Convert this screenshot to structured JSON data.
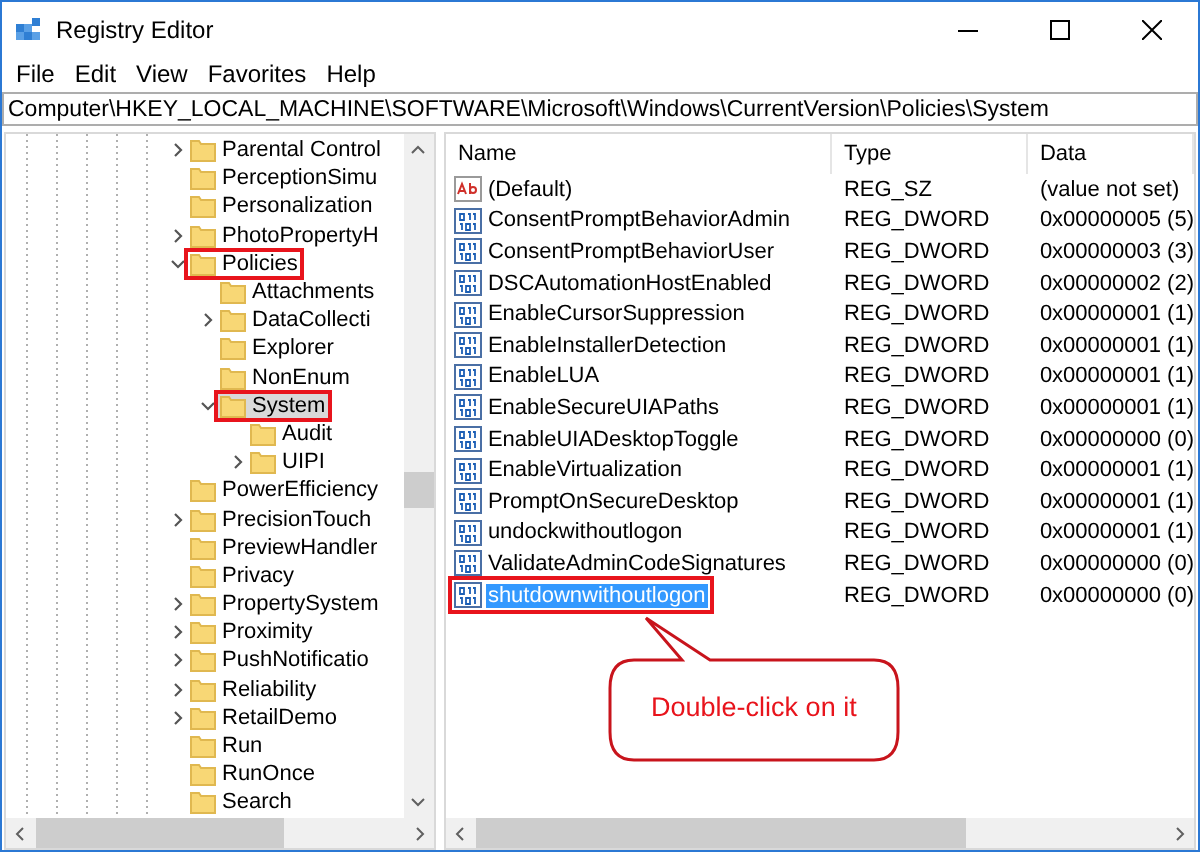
{
  "window": {
    "title": "Registry Editor"
  },
  "menu": [
    "File",
    "Edit",
    "View",
    "Favorites",
    "Help"
  ],
  "address": "Computer\\HKEY_LOCAL_MACHINE\\SOFTWARE\\Microsoft\\Windows\\CurrentVersion\\Policies\\System",
  "tree": [
    {
      "label": "Parental Control",
      "expandable": true,
      "expanded": false,
      "selected": false,
      "highlighted": false
    },
    {
      "label": "PerceptionSimu",
      "expandable": false,
      "selected": false,
      "highlighted": false
    },
    {
      "label": "Personalization",
      "expandable": false,
      "selected": false,
      "highlighted": false
    },
    {
      "label": "PhotoPropertyH",
      "expandable": true,
      "expanded": false,
      "selected": false,
      "highlighted": false
    },
    {
      "label": "Policies",
      "expandable": true,
      "expanded": true,
      "selected": false,
      "highlighted": true,
      "children": [
        {
          "label": "Attachments",
          "expandable": false,
          "selected": false,
          "highlighted": false
        },
        {
          "label": "DataCollecti",
          "expandable": true,
          "expanded": false,
          "selected": false,
          "highlighted": false
        },
        {
          "label": "Explorer",
          "expandable": false,
          "selected": false,
          "highlighted": false
        },
        {
          "label": "NonEnum",
          "expandable": false,
          "selected": false,
          "highlighted": false
        },
        {
          "label": "System",
          "expandable": true,
          "expanded": true,
          "selected": true,
          "highlighted": true,
          "children": [
            {
              "label": "Audit",
              "expandable": false,
              "selected": false,
              "highlighted": false
            },
            {
              "label": "UIPI",
              "expandable": true,
              "expanded": false,
              "selected": false,
              "highlighted": false
            }
          ]
        }
      ]
    },
    {
      "label": "PowerEfficiency",
      "expandable": false,
      "selected": false,
      "highlighted": false
    },
    {
      "label": "PrecisionTouch",
      "expandable": true,
      "expanded": false,
      "selected": false,
      "highlighted": false
    },
    {
      "label": "PreviewHandler",
      "expandable": false,
      "selected": false,
      "highlighted": false
    },
    {
      "label": "Privacy",
      "expandable": false,
      "selected": false,
      "highlighted": false
    },
    {
      "label": "PropertySystem",
      "expandable": true,
      "expanded": false,
      "selected": false,
      "highlighted": false
    },
    {
      "label": "Proximity",
      "expandable": true,
      "expanded": false,
      "selected": false,
      "highlighted": false
    },
    {
      "label": "PushNotificatio",
      "expandable": true,
      "expanded": false,
      "selected": false,
      "highlighted": false
    },
    {
      "label": "Reliability",
      "expandable": true,
      "expanded": false,
      "selected": false,
      "highlighted": false
    },
    {
      "label": "RetailDemo",
      "expandable": true,
      "expanded": false,
      "selected": false,
      "highlighted": false
    },
    {
      "label": "Run",
      "expandable": false,
      "selected": false,
      "highlighted": false
    },
    {
      "label": "RunOnce",
      "expandable": false,
      "selected": false,
      "highlighted": false
    },
    {
      "label": "Search",
      "expandable": false,
      "selected": false,
      "highlighted": false
    }
  ],
  "table": {
    "columns": [
      "Name",
      "Type",
      "Data"
    ],
    "rows": [
      {
        "kind": "string",
        "name": "(Default)",
        "type": "REG_SZ",
        "data": "(value not set)",
        "selected": false,
        "highlighted": false
      },
      {
        "kind": "dword",
        "name": "ConsentPromptBehaviorAdmin",
        "type": "REG_DWORD",
        "data": "0x00000005 (5)",
        "selected": false,
        "highlighted": false
      },
      {
        "kind": "dword",
        "name": "ConsentPromptBehaviorUser",
        "type": "REG_DWORD",
        "data": "0x00000003 (3)",
        "selected": false,
        "highlighted": false
      },
      {
        "kind": "dword",
        "name": "DSCAutomationHostEnabled",
        "type": "REG_DWORD",
        "data": "0x00000002 (2)",
        "selected": false,
        "highlighted": false
      },
      {
        "kind": "dword",
        "name": "EnableCursorSuppression",
        "type": "REG_DWORD",
        "data": "0x00000001 (1)",
        "selected": false,
        "highlighted": false
      },
      {
        "kind": "dword",
        "name": "EnableInstallerDetection",
        "type": "REG_DWORD",
        "data": "0x00000001 (1)",
        "selected": false,
        "highlighted": false
      },
      {
        "kind": "dword",
        "name": "EnableLUA",
        "type": "REG_DWORD",
        "data": "0x00000001 (1)",
        "selected": false,
        "highlighted": false
      },
      {
        "kind": "dword",
        "name": "EnableSecureUIAPaths",
        "type": "REG_DWORD",
        "data": "0x00000001 (1)",
        "selected": false,
        "highlighted": false
      },
      {
        "kind": "dword",
        "name": "EnableUIADesktopToggle",
        "type": "REG_DWORD",
        "data": "0x00000000 (0)",
        "selected": false,
        "highlighted": false
      },
      {
        "kind": "dword",
        "name": "EnableVirtualization",
        "type": "REG_DWORD",
        "data": "0x00000001 (1)",
        "selected": false,
        "highlighted": false
      },
      {
        "kind": "dword",
        "name": "PromptOnSecureDesktop",
        "type": "REG_DWORD",
        "data": "0x00000001 (1)",
        "selected": false,
        "highlighted": false
      },
      {
        "kind": "dword",
        "name": "undockwithoutlogon",
        "type": "REG_DWORD",
        "data": "0x00000001 (1)",
        "selected": false,
        "highlighted": false
      },
      {
        "kind": "dword",
        "name": "ValidateAdminCodeSignatures",
        "type": "REG_DWORD",
        "data": "0x00000000 (0)",
        "selected": false,
        "highlighted": false
      },
      {
        "kind": "dword",
        "name": "shutdownwithoutlogon",
        "type": "REG_DWORD",
        "data": "0x00000000 (0)",
        "selected": true,
        "highlighted": true
      }
    ]
  },
  "callout": "Double-click on it"
}
